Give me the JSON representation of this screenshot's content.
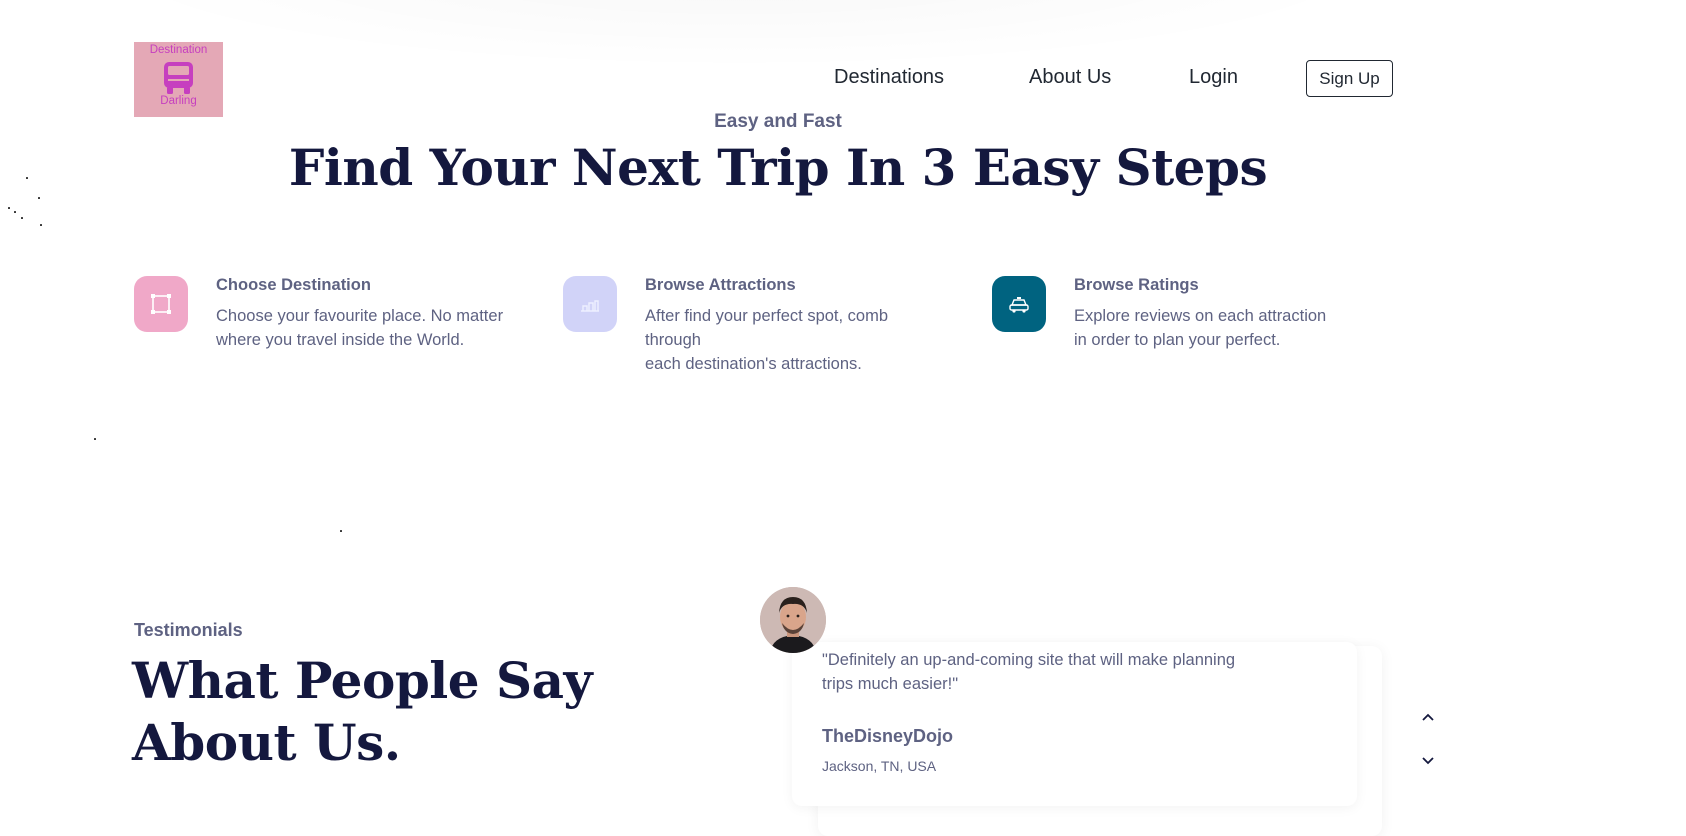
{
  "logo": {
    "top_text": "Destination",
    "bottom_text": "Darling",
    "icon": "bus-icon",
    "bg_color": "#e4a8b6",
    "text_color": "#c63fbf"
  },
  "nav": {
    "items": [
      "Destinations",
      "About Us",
      "Login"
    ],
    "signup_label": "Sign Up"
  },
  "hero": {
    "eyebrow": "Easy and Fast",
    "title": "Find Your Next Trip In 3 Easy Steps"
  },
  "steps": [
    {
      "title": "Choose Destination",
      "desc_lines": [
        "Choose your favourite place. No matter",
        "where you travel inside the World."
      ],
      "icon": "selection-square-icon",
      "icon_bg": "#f0a8c8"
    },
    {
      "title": "Browse Attractions",
      "desc_lines": [
        "After find your perfect spot, comb",
        "through",
        "each destination's attractions."
      ],
      "icon": "attractions-icon",
      "icon_bg": "#d1d3f8"
    },
    {
      "title": "Browse Ratings",
      "desc_lines": [
        "Explore reviews on each attraction",
        "in order to plan your perfect."
      ],
      "icon": "taxi-icon",
      "icon_bg": "#006380"
    }
  ],
  "testimonials": {
    "eyebrow": "Testimonials",
    "title_lines": [
      "What People Say",
      "About Us."
    ],
    "card": {
      "quote_lines": [
        "\"Definitely an up-and-coming site that will make planning",
        "trips much easier!\""
      ],
      "author": "TheDisneyDojo",
      "location": "Jackson, TN, USA"
    },
    "controls": [
      "chevron-up-icon",
      "chevron-down-icon"
    ]
  },
  "colors": {
    "heading": "#14183e",
    "body_text": "#5e6282",
    "nav_text": "#212832"
  }
}
